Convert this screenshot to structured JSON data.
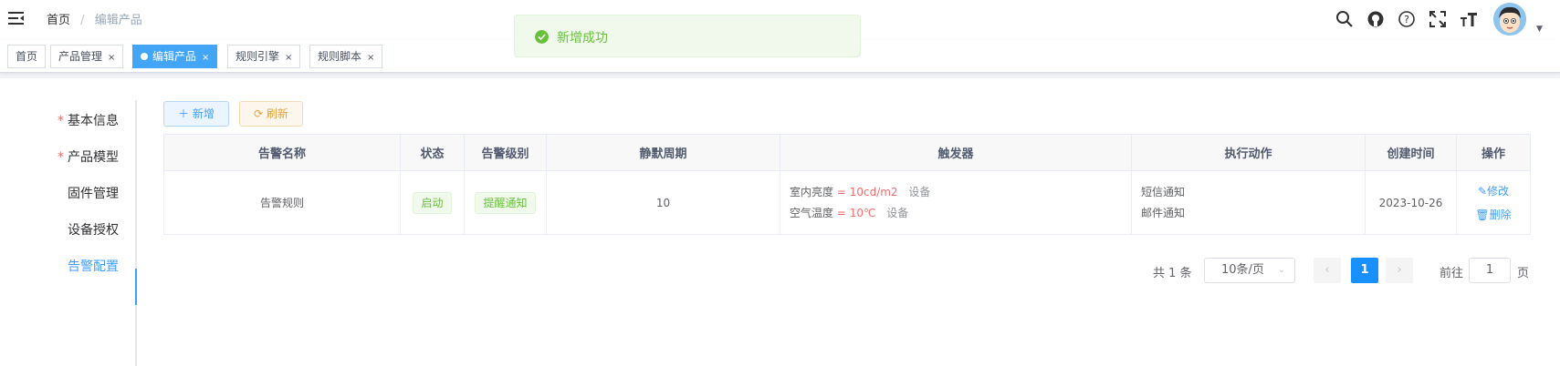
{
  "breadcrumb": {
    "home": "首页",
    "separator": "/",
    "current": "编辑产品"
  },
  "header_icons": [
    "search-icon",
    "github-icon",
    "help-icon",
    "fullscreen-icon",
    "font-size-icon"
  ],
  "tags": [
    {
      "label": "首页",
      "closable": false,
      "active": false
    },
    {
      "label": "产品管理",
      "closable": true,
      "active": false
    },
    {
      "label": "编辑产品",
      "closable": true,
      "active": true
    },
    {
      "label": "规则引擎",
      "closable": true,
      "active": false
    },
    {
      "label": "规则脚本",
      "closable": true,
      "active": false
    }
  ],
  "tag_close": "×",
  "toast": {
    "message": "新增成功",
    "color": "#67c23a"
  },
  "sidebar": {
    "required_mark": "*",
    "items": [
      {
        "label": "基本信息",
        "required": true,
        "active": false
      },
      {
        "label": "产品模型",
        "required": true,
        "active": false
      },
      {
        "label": "固件管理",
        "required": false,
        "active": false
      },
      {
        "label": "设备授权",
        "required": false,
        "active": false
      },
      {
        "label": "告警配置",
        "required": false,
        "active": true
      }
    ]
  },
  "toolbar": {
    "add_label": "新增",
    "refresh_label": "刷新"
  },
  "table": {
    "columns": [
      "告警名称",
      "状态",
      "告警级别",
      "静默周期",
      "触发器",
      "执行动作",
      "创建时间",
      "操作"
    ],
    "rows": [
      {
        "name": "告警规则",
        "status": "启动",
        "level": "提醒通知",
        "silence": "10",
        "triggers": [
          {
            "name": "室内亮度",
            "condition": "= 10cd/m2",
            "source": "设备"
          },
          {
            "name": "空气温度",
            "condition": "= 10℃",
            "source": "设备"
          }
        ],
        "actions": [
          "短信通知",
          "邮件通知"
        ],
        "created": "2023-10-26",
        "edit_label": "修改",
        "delete_label": "删除"
      }
    ]
  },
  "pagination": {
    "total_text": "共 1 条",
    "page_size": "10条/页",
    "current_page": "1",
    "goto_label": "前往",
    "goto_value": "1",
    "page_suffix": "页"
  },
  "colors": {
    "primary": "#409eff",
    "success": "#67c23a",
    "danger": "#f56c6c",
    "warning": "#e6a23c"
  }
}
